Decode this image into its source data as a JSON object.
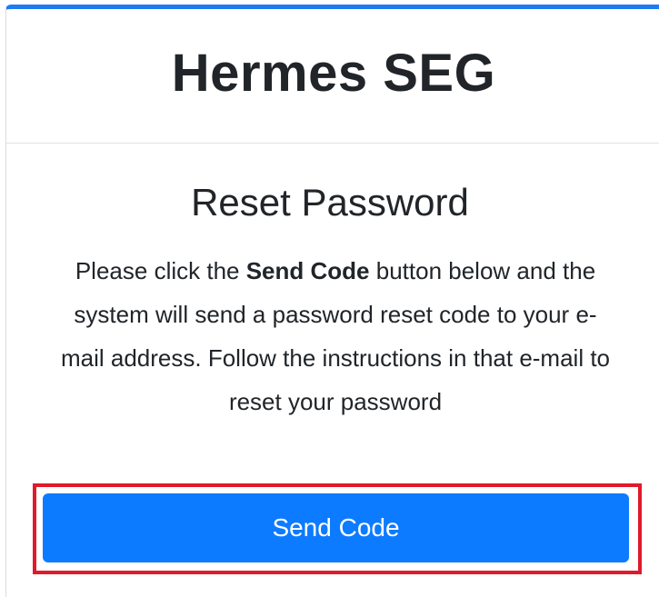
{
  "header": {
    "title": "Hermes SEG"
  },
  "reset": {
    "title": "Reset Password",
    "instructions_before": "Please click the ",
    "instructions_bold": "Send Code",
    "instructions_after": " button below and the system will send a password reset code to your e-mail address. Follow the instructions in that e-mail to reset your password"
  },
  "actions": {
    "send_code_label": "Send Code"
  },
  "colors": {
    "accent": "#1e7bf2",
    "button": "#0d7bff",
    "highlight": "#e0192b"
  }
}
